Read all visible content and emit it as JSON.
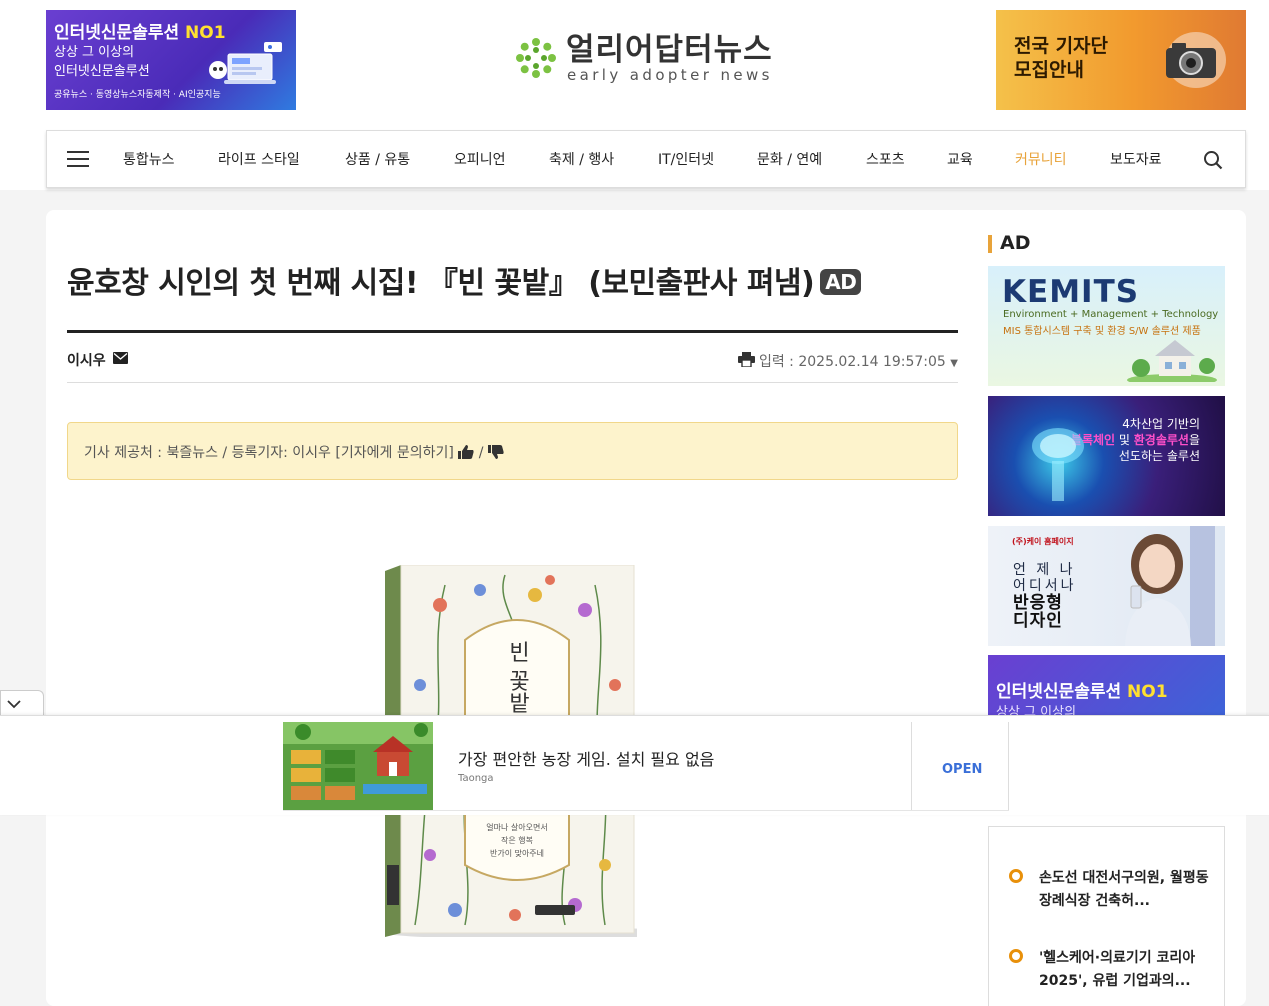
{
  "header": {
    "banner_left": {
      "line1": "인터넷신문솔루션",
      "line1_accent": "NO1",
      "line2": "상상 그 이상의",
      "line3": "인터넷신문솔루션",
      "line4": "공유뉴스 · 동영상뉴스자동제작 · AI인공지능"
    },
    "logo": {
      "ko": "얼리어답터뉴스",
      "en": "early adopter news"
    },
    "banner_right": {
      "text": "전국 기자단 모집안내"
    }
  },
  "nav": {
    "items": [
      "통합뉴스",
      "라이프 스타일",
      "상품 / 유통",
      "오피니언",
      "축제 / 행사",
      "IT/인터넷",
      "문화 / 연예",
      "스포츠",
      "교육",
      "커뮤니티",
      "보도자료"
    ],
    "accent_item": "커뮤니티",
    "accent_color": "#e8a33a"
  },
  "article": {
    "title": "윤호창 시인의 첫 번째 시집! 『빈 꽃밭』 (보민출판사 펴냄)",
    "badge": "AD",
    "author": "이시우",
    "date_label": "입력 : 2025.02.14 19:57:05",
    "source_text": "기사 제공처 : 북즐뉴스 / 등록기자: 이시우 [기자에게 문의하기]",
    "source_sep": "/",
    "book_cover_title": "빈 꽃밭",
    "book_cover_lines": [
      "얼마나 살아오면서",
      "작은 행복",
      "반가이 맞아주네"
    ]
  },
  "sidebar": {
    "ad_heading": "AD",
    "banners": {
      "kemits_title": "KEMITS",
      "kemits_sub1": "Environment + Management + Technology",
      "kemits_sub2": "MIS 통합시스템 구축 및 환경 S/W 솔루션 제품",
      "b2_line1": "4차산업 기반의",
      "b2_line2a": "블록체인",
      "b2_line2b": " 및 ",
      "b2_line2c": "환경솔루션",
      "b2_line2d": "을",
      "b2_line3": "선도하는 솔루션",
      "b3_brand": "(주)케이 홈페이지",
      "b3_line1": "언 제 나",
      "b3_line2": "어디서나",
      "b3_line3": "반응형",
      "b3_line4": "디자인",
      "b4_line1": "인터넷신문솔루션",
      "b4_accent": "NO1",
      "b4_line2": "상상 그 이상의"
    },
    "popular": [
      "손도선 대전서구의원, 월평동 장례식장 건축허...",
      "'헬스케어·의료기기 코리아 2025', 유럽 기업과의..."
    ]
  },
  "overlay_ad": {
    "title": "가장 편안한 농장 게임. 설치 필요 없음",
    "advertiser": "Taonga",
    "cta": "OPEN"
  }
}
